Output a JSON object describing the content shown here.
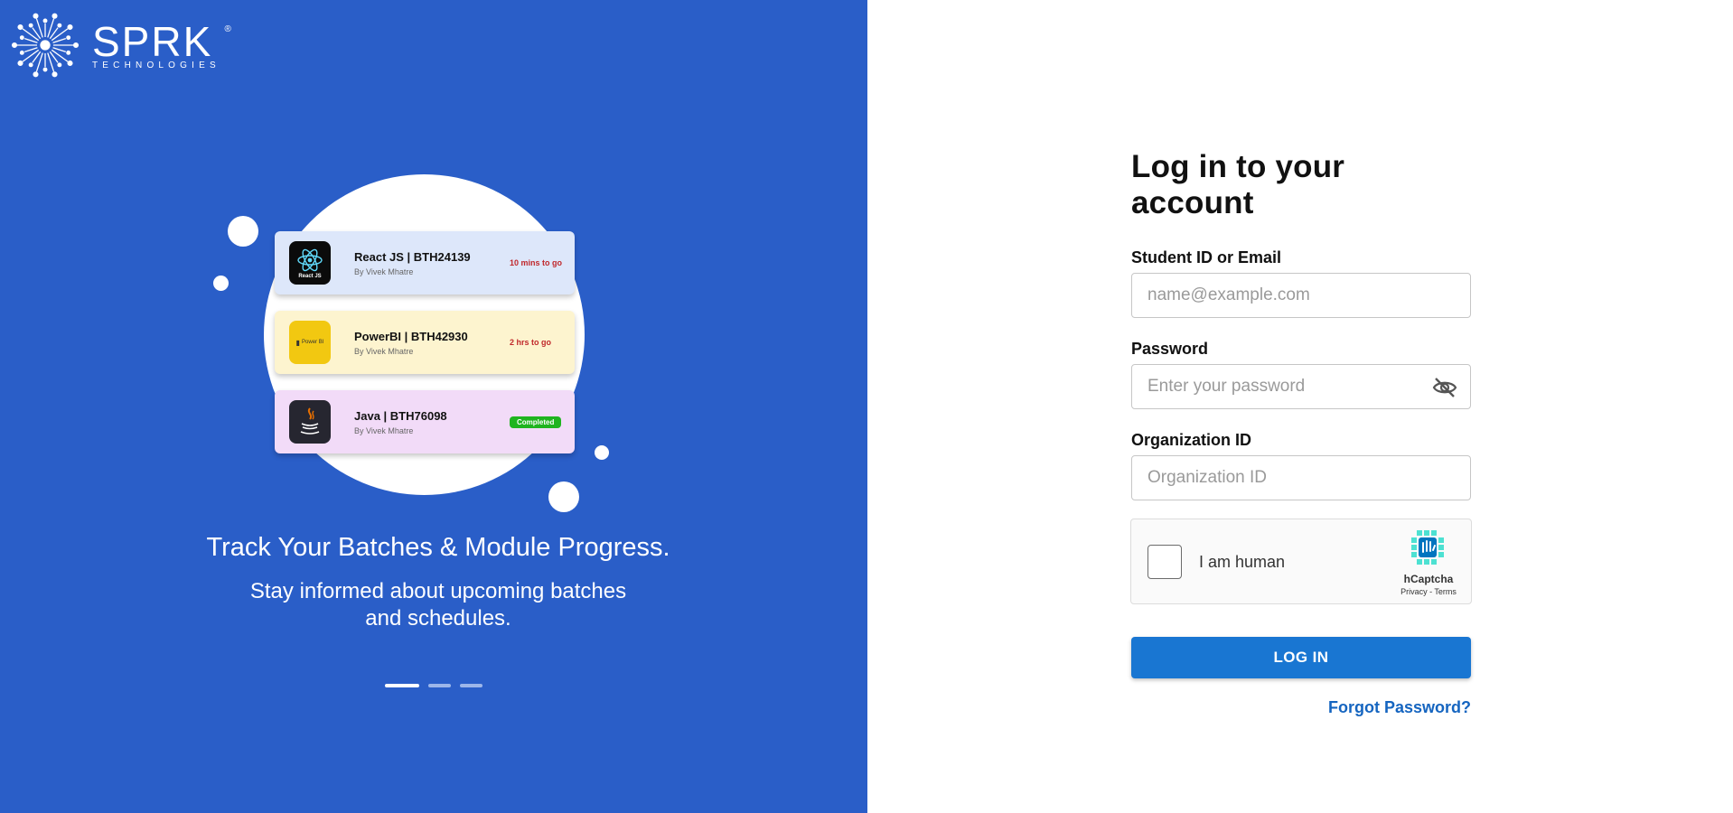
{
  "brand": {
    "name": "SPRK",
    "registered": "®",
    "subtitle": "TECHNOLOGIES"
  },
  "colors": {
    "left_panel": "#2a5ec8",
    "primary_button": "#1976d2",
    "link": "#1565c0",
    "badge_completed": "#1fb41f",
    "status_pending": "#c0282b"
  },
  "illustration": {
    "cards": [
      {
        "icon": "react-icon",
        "icon_caption": "React JS",
        "title": "React JS | BTH24139",
        "by": "By Vivek Mhatre",
        "status": "10 mins to go",
        "bg": "#dde7fa"
      },
      {
        "icon": "powerbi-icon",
        "icon_caption": "Power BI",
        "title": "PowerBI | BTH42930",
        "by": "By Vivek Mhatre",
        "status": "2 hrs to go",
        "bg": "#fdf4cf"
      },
      {
        "icon": "java-icon",
        "title": "Java | BTH76098",
        "by": "By Vivek Mhatre",
        "status": "Completed",
        "bg": "#f2dbf8"
      }
    ]
  },
  "slide": {
    "title": "Track Your Batches & Module Progress.",
    "subtitle": "Stay informed about upcoming batches and schedules.",
    "current": 1,
    "total": 3
  },
  "form": {
    "title": "Log in to your account",
    "email_label": "Student ID or Email",
    "email_placeholder": "name@example.com",
    "password_label": "Password",
    "password_placeholder": "Enter your password",
    "org_label": "Organization ID",
    "org_placeholder": "Organization ID",
    "captcha_label": "I am human",
    "captcha_brand": "hCaptcha",
    "captcha_links": "Privacy - Terms",
    "login_button": "LOG IN",
    "forgot_link": "Forgot Password?"
  }
}
